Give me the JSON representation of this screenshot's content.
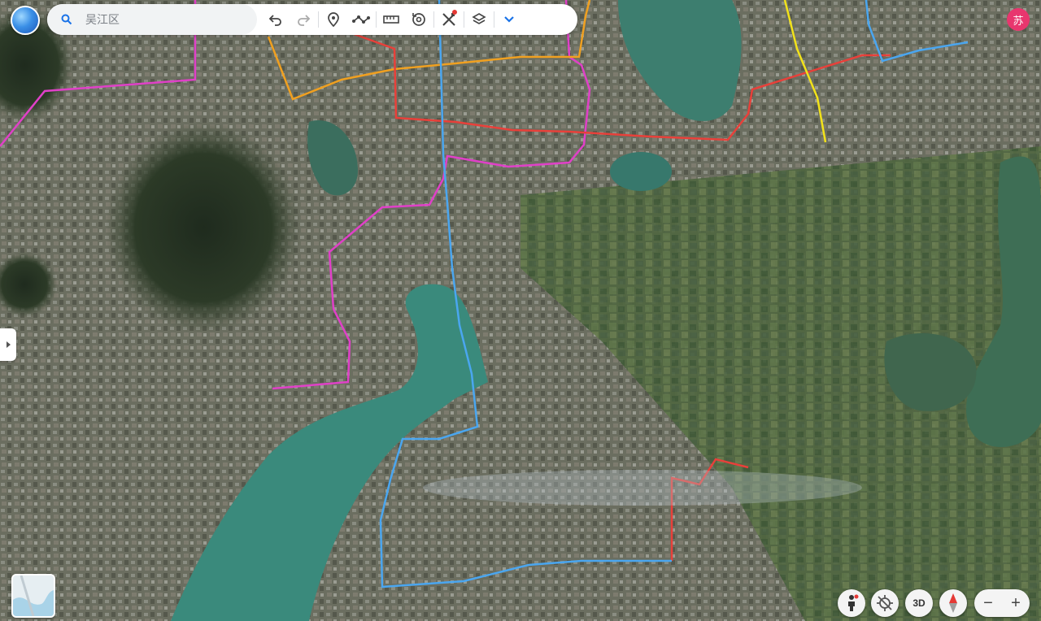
{
  "search": {
    "placeholder": "吴江区"
  },
  "toolbar": {
    "buttons": [
      {
        "name": "undo-icon"
      },
      {
        "name": "redo-icon"
      },
      {
        "name": "placemark-icon"
      },
      {
        "name": "path-icon"
      },
      {
        "name": "ruler-icon"
      },
      {
        "name": "history-icon"
      },
      {
        "name": "tools-icon"
      },
      {
        "name": "layers-icon"
      },
      {
        "name": "chevron-down-icon"
      }
    ]
  },
  "user": {
    "avatar_text": "苏"
  },
  "controls": {
    "view_3d_label": "3D",
    "zoom_out_label": "−",
    "zoom_in_label": "+"
  },
  "colors": {
    "route_magenta": "#e040c8",
    "route_orange": "#f0a020",
    "route_red": "#e8403a",
    "route_blue": "#4aa6f0",
    "route_yellow": "#f2e21a",
    "avatar": "#e8366e"
  }
}
